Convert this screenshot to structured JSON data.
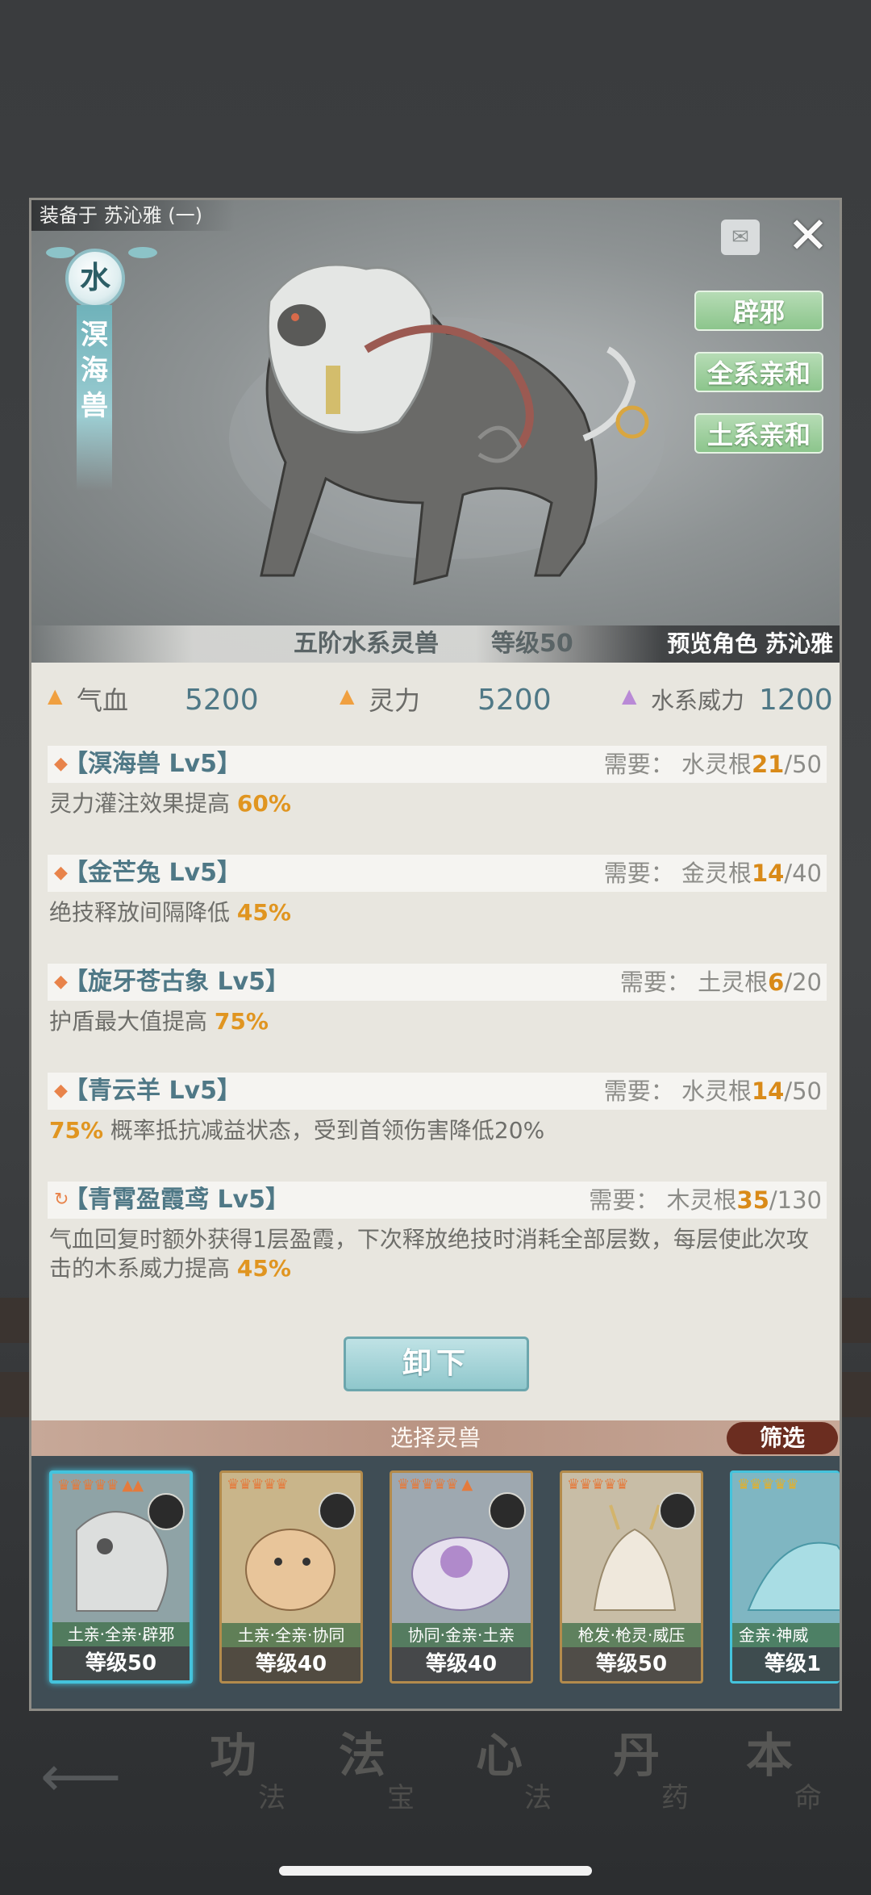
{
  "equip_label": "装备于 苏沁雅 (一)",
  "element": "水",
  "beast_name_vertical": "溟海兽",
  "traits": [
    "辟邪",
    "全系亲和",
    "土系亲和"
  ],
  "tier": "五阶水系灵兽",
  "level_label": "等级50",
  "preview": "预览角色 苏沁雅",
  "stats": [
    {
      "label": "气血",
      "value": "5200",
      "icon": "triangle-up-icon",
      "color": "#f0a040"
    },
    {
      "label": "灵力",
      "value": "5200",
      "icon": "triangle-up-icon",
      "color": "#f0a040"
    },
    {
      "label": "水系威力",
      "value": "1200",
      "icon": "triangle-up-icon",
      "color": "#b98ad6"
    }
  ],
  "skills": [
    {
      "name": "【溟海兽 Lv5】",
      "req_prefix": "需要：  水灵根",
      "req_cur": "21",
      "req_max": "/50",
      "desc_pre": "灵力灌注效果提高 ",
      "desc_hl": "60%",
      "desc_post": "",
      "icon": "diamond-icon"
    },
    {
      "name": "【金芒兔 Lv5】",
      "req_prefix": "需要：  金灵根",
      "req_cur": "14",
      "req_max": "/40",
      "desc_pre": "绝技释放间隔降低 ",
      "desc_hl": "45%",
      "desc_post": "",
      "icon": "diamond-icon"
    },
    {
      "name": "【旋牙苍古象 Lv5】",
      "req_prefix": "需要：  土灵根",
      "req_cur": "6",
      "req_max": "/20",
      "desc_pre": "护盾最大值提高 ",
      "desc_hl": "75%",
      "desc_post": "",
      "icon": "diamond-icon"
    },
    {
      "name": "【青云羊 Lv5】",
      "req_prefix": "需要：  水灵根",
      "req_cur": "14",
      "req_max": "/50",
      "desc_pre": "",
      "desc_hl": "75%",
      "desc_post": " 概率抵抗减益状态，受到首领伤害降低20%",
      "icon": "diamond-icon"
    },
    {
      "name": "【青霄盈霞鸢 Lv5】",
      "req_prefix": "需要：  木灵根",
      "req_cur": "35",
      "req_max": "/130",
      "desc_pre": "气血回复时额外获得1层盈霞，下次释放绝技时消耗全部层数，每层使此次攻击的木系威力提高 ",
      "desc_hl": "45%",
      "desc_post": "",
      "icon": "refresh-icon"
    }
  ],
  "unequip_label": "卸下",
  "select_title": "选择灵兽",
  "filter_label": "筛选",
  "cards": [
    {
      "tags": "土亲·全亲·辟邪",
      "level": "等级50",
      "bg": "#8fa3a6"
    },
    {
      "tags": "土亲·全亲·协同",
      "level": "等级40",
      "bg": "#c9b58a"
    },
    {
      "tags": "协同·金亲·土亲",
      "level": "等级40",
      "bg": "#9ea8b0"
    },
    {
      "tags": "枪发·枪灵·威压",
      "level": "等级50",
      "bg": "#c8bda6"
    },
    {
      "tags": "金亲·神威",
      "level": "等级1",
      "bg": "#7fb6c2"
    }
  ],
  "bottom_nav": [
    {
      "big": "功",
      "small": "法"
    },
    {
      "big": "法",
      "small": "宝"
    },
    {
      "big": "心",
      "small": "法"
    },
    {
      "big": "丹",
      "small": "药"
    },
    {
      "big": "本",
      "small": "命"
    }
  ]
}
